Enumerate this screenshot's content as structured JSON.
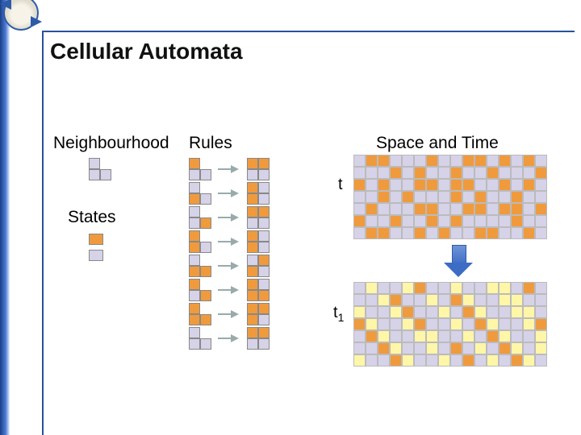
{
  "title": "Cellular Automata",
  "columns": {
    "neighbourhood": "Neighbourhood",
    "rules": "Rules",
    "space_time": "Space and Time"
  },
  "states_label": "States",
  "time_labels": {
    "t": "t",
    "t1_base": "t",
    "t1_sub": "1"
  },
  "states": [
    {
      "name": "state-active",
      "color": "#f09a3e"
    },
    {
      "name": "state-passive",
      "color": "#d6d2e8"
    }
  ],
  "neighbourhood_shape": "L-tromino (3 cells: top-left, bottom-left, bottom-right)",
  "rules_note": "Each rule: 2x2 input block → 2x2 output block. 1=orange active, 0=lavender passive, order TL,TR,BL,BR (TR absent in input shape).",
  "rules": [
    {
      "in": [
        1,
        null,
        0,
        0
      ],
      "out": [
        1,
        1,
        0,
        0
      ]
    },
    {
      "in": [
        0,
        null,
        1,
        0
      ],
      "out": [
        1,
        0,
        1,
        0
      ]
    },
    {
      "in": [
        0,
        null,
        0,
        1
      ],
      "out": [
        1,
        1,
        0,
        0
      ]
    },
    {
      "in": [
        1,
        null,
        1,
        0
      ],
      "out": [
        1,
        0,
        1,
        0
      ]
    },
    {
      "in": [
        0,
        null,
        1,
        1
      ],
      "out": [
        0,
        1,
        1,
        0
      ]
    },
    {
      "in": [
        1,
        null,
        0,
        1
      ],
      "out": [
        1,
        0,
        1,
        1
      ]
    },
    {
      "in": [
        1,
        null,
        1,
        1
      ],
      "out": [
        1,
        1,
        1,
        0
      ]
    },
    {
      "in": [
        0,
        null,
        0,
        0
      ],
      "out": [
        1,
        1,
        0,
        0
      ]
    }
  ],
  "grid_dims": {
    "cols": 16,
    "rows_t": 7,
    "rows_t1": 7
  },
  "grid_t_legend": "0=lavender, 1=orange",
  "grid_t": [
    [
      0,
      1,
      1,
      0,
      0,
      0,
      1,
      0,
      0,
      1,
      1,
      0,
      1,
      0,
      1,
      0
    ],
    [
      0,
      0,
      0,
      1,
      0,
      1,
      0,
      0,
      1,
      0,
      0,
      1,
      0,
      0,
      0,
      1
    ],
    [
      1,
      0,
      1,
      0,
      0,
      1,
      1,
      0,
      1,
      1,
      0,
      0,
      1,
      0,
      1,
      0
    ],
    [
      0,
      0,
      1,
      0,
      1,
      0,
      0,
      0,
      1,
      0,
      1,
      0,
      0,
      1,
      0,
      0
    ],
    [
      0,
      1,
      0,
      0,
      0,
      1,
      1,
      0,
      0,
      1,
      1,
      0,
      1,
      1,
      0,
      1
    ],
    [
      1,
      0,
      0,
      1,
      0,
      0,
      1,
      0,
      1,
      0,
      0,
      0,
      0,
      1,
      0,
      0
    ],
    [
      0,
      1,
      1,
      0,
      0,
      1,
      0,
      1,
      0,
      0,
      1,
      1,
      0,
      0,
      1,
      0
    ]
  ],
  "grid_t1_legend": "0=lavender, 1=orange, 2=pale-yellow",
  "grid_t1": [
    [
      0,
      2,
      0,
      0,
      2,
      1,
      0,
      0,
      2,
      0,
      0,
      2,
      2,
      0,
      1,
      0
    ],
    [
      0,
      0,
      2,
      1,
      0,
      0,
      2,
      0,
      1,
      2,
      0,
      0,
      2,
      2,
      0,
      0
    ],
    [
      2,
      0,
      0,
      2,
      1,
      0,
      0,
      2,
      0,
      1,
      2,
      0,
      0,
      2,
      2,
      0
    ],
    [
      1,
      2,
      0,
      0,
      2,
      1,
      0,
      0,
      2,
      0,
      1,
      2,
      0,
      0,
      2,
      1
    ],
    [
      0,
      1,
      2,
      0,
      0,
      2,
      2,
      0,
      0,
      2,
      0,
      1,
      2,
      0,
      0,
      2
    ],
    [
      0,
      0,
      1,
      2,
      0,
      0,
      2,
      0,
      1,
      0,
      2,
      0,
      1,
      2,
      0,
      2
    ],
    [
      2,
      0,
      0,
      1,
      2,
      0,
      0,
      2,
      0,
      1,
      0,
      2,
      0,
      1,
      2,
      0
    ]
  ]
}
